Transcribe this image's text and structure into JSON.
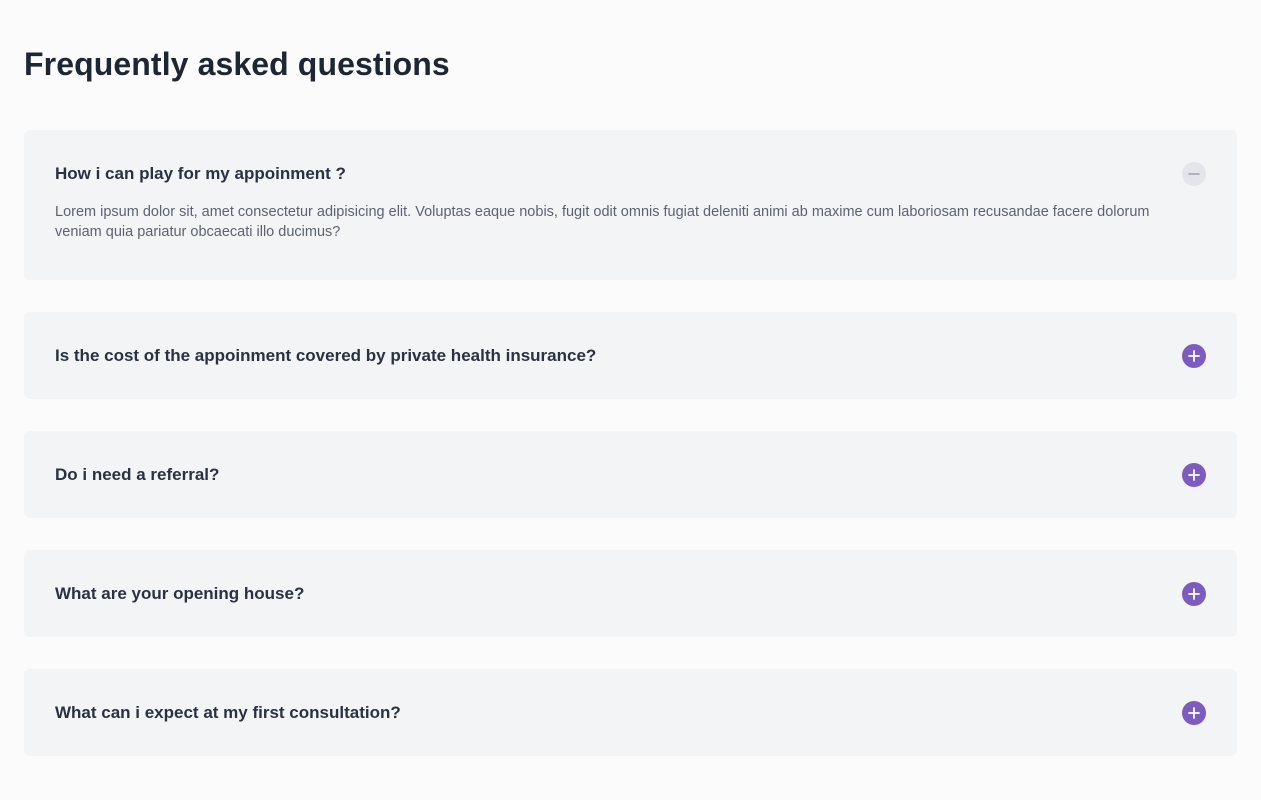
{
  "page": {
    "title": "Frequently asked questions"
  },
  "colors": {
    "background": "#fbfbfc",
    "card": "#f3f4f6",
    "accent": "#7c5cbf",
    "collapse_bg": "#e3e5ea",
    "heading": "#1e2533"
  },
  "faq": {
    "items": [
      {
        "question": "How i can play for my appoinment ?",
        "answer": "Lorem ipsum dolor sit, amet consectetur adipisicing elit. Voluptas eaque nobis, fugit odit omnis fugiat deleniti animi ab maxime cum laboriosam recusandae facere dolorum veniam quia pariatur obcaecati illo ducimus?",
        "expanded": true,
        "icon": "minus-icon"
      },
      {
        "question": "Is the cost of the appoinment covered by private health insurance?",
        "expanded": false,
        "icon": "plus-icon"
      },
      {
        "question": "Do i need a referral?",
        "expanded": false,
        "icon": "plus-icon"
      },
      {
        "question": "What are your opening house?",
        "expanded": false,
        "icon": "plus-icon"
      },
      {
        "question": "What can i expect at my first consultation?",
        "expanded": false,
        "icon": "plus-icon"
      }
    ]
  }
}
